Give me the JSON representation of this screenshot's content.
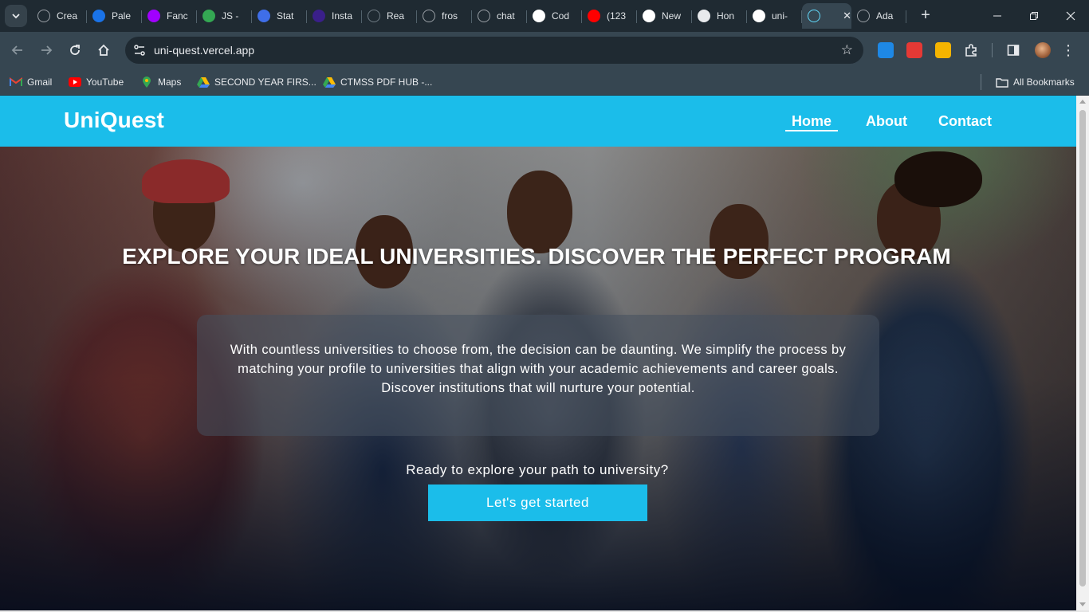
{
  "browser": {
    "tabs": [
      {
        "title": "Crea",
        "icon": "globe-icon",
        "color": "#9aa0a6"
      },
      {
        "title": "Pale",
        "icon": "c-logo-icon",
        "color": "#1a73e8"
      },
      {
        "title": "Fanc",
        "icon": "blob-icon",
        "color": "#a100ff"
      },
      {
        "title": "JS -",
        "icon": "drive-icon",
        "color": "#34a853"
      },
      {
        "title": "Stat",
        "icon": "f-logo-icon",
        "color": "#3f6ee8"
      },
      {
        "title": "Insta",
        "icon": "r-logo-icon",
        "color": "#3a1f8a"
      },
      {
        "title": "Rea",
        "icon": "scan-icon",
        "color": "#6f7b84"
      },
      {
        "title": "fros",
        "icon": "openai-icon",
        "color": "#9aa0a6"
      },
      {
        "title": "chat",
        "icon": "openai-icon",
        "color": "#9aa0a6"
      },
      {
        "title": "Cod",
        "icon": "github-icon",
        "color": "#ffffff"
      },
      {
        "title": "(123",
        "icon": "youtube-icon",
        "color": "#ff0000"
      },
      {
        "title": "New",
        "icon": "shield-icon",
        "color": "#ffffff"
      },
      {
        "title": "Hon",
        "icon": "dots-icon",
        "color": "#e8eaed"
      },
      {
        "title": "uni-",
        "icon": "triangle-icon",
        "color": "#ffffff"
      },
      {
        "title": "",
        "icon": "react-icon",
        "color": "#61dafb"
      },
      {
        "title": "Ada",
        "icon": "globe-icon",
        "color": "#9aa0a6"
      }
    ],
    "active_tab_close": "✕",
    "new_tab_label": "+",
    "address": "uni-quest.vercel.app",
    "bookmarks": [
      {
        "label": "Gmail",
        "icon": "gmail-icon"
      },
      {
        "label": "YouTube",
        "icon": "youtube-icon"
      },
      {
        "label": "Maps",
        "icon": "maps-icon"
      },
      {
        "label": "SECOND YEAR FIRS...",
        "icon": "drive-icon"
      },
      {
        "label": "CTMSS PDF HUB -...",
        "icon": "drive-icon"
      }
    ],
    "all_bookmarks": "All Bookmarks"
  },
  "site": {
    "brand": "UniQuest",
    "nav": {
      "home": "Home",
      "about": "About",
      "contact": "Contact"
    },
    "headline": "EXPLORE YOUR IDEAL UNIVERSITIES. DISCOVER THE PERFECT PROGRAM",
    "description": "With countless universities to choose from, the decision can be daunting. We simplify the process by matching your profile to universities that align with your academic achievements and career goals. Discover institutions that will nurture your potential.",
    "prompt": "Ready to explore your path to university?",
    "cta": "Let's get started",
    "accent": "#1bbdea"
  }
}
